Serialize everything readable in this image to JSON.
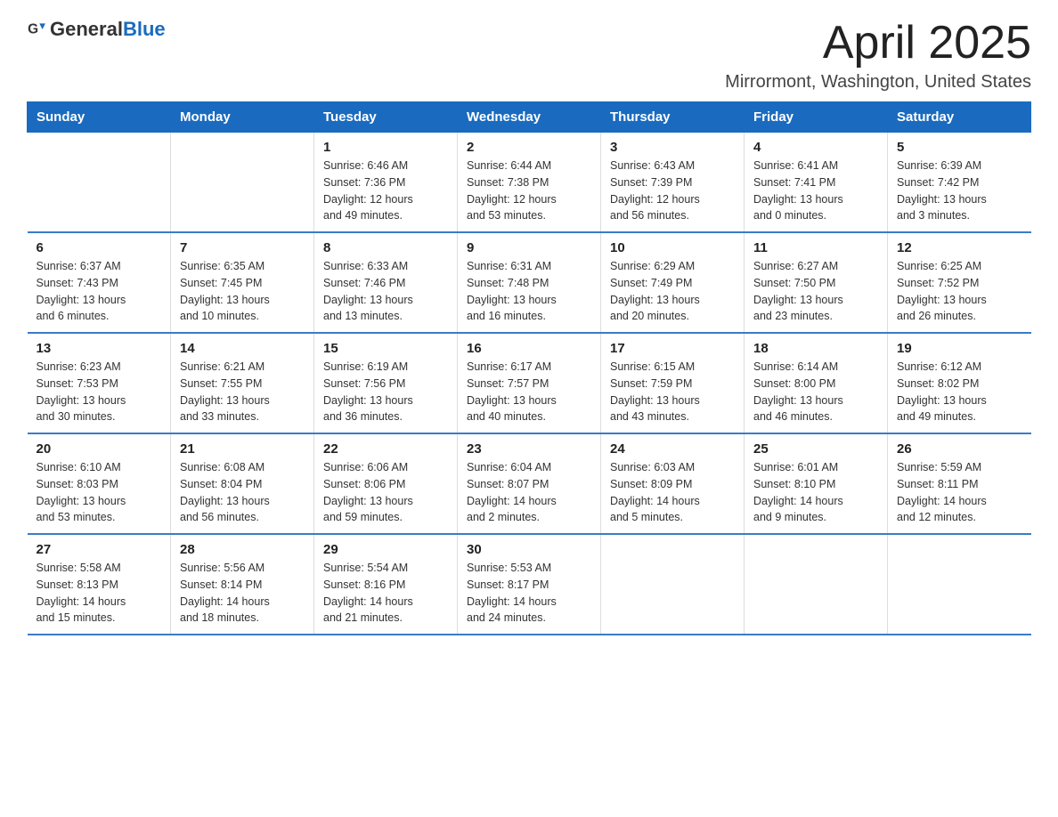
{
  "logo": {
    "text_general": "General",
    "text_blue": "Blue"
  },
  "title": "April 2025",
  "location": "Mirrormont, Washington, United States",
  "days_of_week": [
    "Sunday",
    "Monday",
    "Tuesday",
    "Wednesday",
    "Thursday",
    "Friday",
    "Saturday"
  ],
  "weeks": [
    [
      {
        "day": "",
        "info": ""
      },
      {
        "day": "",
        "info": ""
      },
      {
        "day": "1",
        "info": "Sunrise: 6:46 AM\nSunset: 7:36 PM\nDaylight: 12 hours\nand 49 minutes."
      },
      {
        "day": "2",
        "info": "Sunrise: 6:44 AM\nSunset: 7:38 PM\nDaylight: 12 hours\nand 53 minutes."
      },
      {
        "day": "3",
        "info": "Sunrise: 6:43 AM\nSunset: 7:39 PM\nDaylight: 12 hours\nand 56 minutes."
      },
      {
        "day": "4",
        "info": "Sunrise: 6:41 AM\nSunset: 7:41 PM\nDaylight: 13 hours\nand 0 minutes."
      },
      {
        "day": "5",
        "info": "Sunrise: 6:39 AM\nSunset: 7:42 PM\nDaylight: 13 hours\nand 3 minutes."
      }
    ],
    [
      {
        "day": "6",
        "info": "Sunrise: 6:37 AM\nSunset: 7:43 PM\nDaylight: 13 hours\nand 6 minutes."
      },
      {
        "day": "7",
        "info": "Sunrise: 6:35 AM\nSunset: 7:45 PM\nDaylight: 13 hours\nand 10 minutes."
      },
      {
        "day": "8",
        "info": "Sunrise: 6:33 AM\nSunset: 7:46 PM\nDaylight: 13 hours\nand 13 minutes."
      },
      {
        "day": "9",
        "info": "Sunrise: 6:31 AM\nSunset: 7:48 PM\nDaylight: 13 hours\nand 16 minutes."
      },
      {
        "day": "10",
        "info": "Sunrise: 6:29 AM\nSunset: 7:49 PM\nDaylight: 13 hours\nand 20 minutes."
      },
      {
        "day": "11",
        "info": "Sunrise: 6:27 AM\nSunset: 7:50 PM\nDaylight: 13 hours\nand 23 minutes."
      },
      {
        "day": "12",
        "info": "Sunrise: 6:25 AM\nSunset: 7:52 PM\nDaylight: 13 hours\nand 26 minutes."
      }
    ],
    [
      {
        "day": "13",
        "info": "Sunrise: 6:23 AM\nSunset: 7:53 PM\nDaylight: 13 hours\nand 30 minutes."
      },
      {
        "day": "14",
        "info": "Sunrise: 6:21 AM\nSunset: 7:55 PM\nDaylight: 13 hours\nand 33 minutes."
      },
      {
        "day": "15",
        "info": "Sunrise: 6:19 AM\nSunset: 7:56 PM\nDaylight: 13 hours\nand 36 minutes."
      },
      {
        "day": "16",
        "info": "Sunrise: 6:17 AM\nSunset: 7:57 PM\nDaylight: 13 hours\nand 40 minutes."
      },
      {
        "day": "17",
        "info": "Sunrise: 6:15 AM\nSunset: 7:59 PM\nDaylight: 13 hours\nand 43 minutes."
      },
      {
        "day": "18",
        "info": "Sunrise: 6:14 AM\nSunset: 8:00 PM\nDaylight: 13 hours\nand 46 minutes."
      },
      {
        "day": "19",
        "info": "Sunrise: 6:12 AM\nSunset: 8:02 PM\nDaylight: 13 hours\nand 49 minutes."
      }
    ],
    [
      {
        "day": "20",
        "info": "Sunrise: 6:10 AM\nSunset: 8:03 PM\nDaylight: 13 hours\nand 53 minutes."
      },
      {
        "day": "21",
        "info": "Sunrise: 6:08 AM\nSunset: 8:04 PM\nDaylight: 13 hours\nand 56 minutes."
      },
      {
        "day": "22",
        "info": "Sunrise: 6:06 AM\nSunset: 8:06 PM\nDaylight: 13 hours\nand 59 minutes."
      },
      {
        "day": "23",
        "info": "Sunrise: 6:04 AM\nSunset: 8:07 PM\nDaylight: 14 hours\nand 2 minutes."
      },
      {
        "day": "24",
        "info": "Sunrise: 6:03 AM\nSunset: 8:09 PM\nDaylight: 14 hours\nand 5 minutes."
      },
      {
        "day": "25",
        "info": "Sunrise: 6:01 AM\nSunset: 8:10 PM\nDaylight: 14 hours\nand 9 minutes."
      },
      {
        "day": "26",
        "info": "Sunrise: 5:59 AM\nSunset: 8:11 PM\nDaylight: 14 hours\nand 12 minutes."
      }
    ],
    [
      {
        "day": "27",
        "info": "Sunrise: 5:58 AM\nSunset: 8:13 PM\nDaylight: 14 hours\nand 15 minutes."
      },
      {
        "day": "28",
        "info": "Sunrise: 5:56 AM\nSunset: 8:14 PM\nDaylight: 14 hours\nand 18 minutes."
      },
      {
        "day": "29",
        "info": "Sunrise: 5:54 AM\nSunset: 8:16 PM\nDaylight: 14 hours\nand 21 minutes."
      },
      {
        "day": "30",
        "info": "Sunrise: 5:53 AM\nSunset: 8:17 PM\nDaylight: 14 hours\nand 24 minutes."
      },
      {
        "day": "",
        "info": ""
      },
      {
        "day": "",
        "info": ""
      },
      {
        "day": "",
        "info": ""
      }
    ]
  ]
}
